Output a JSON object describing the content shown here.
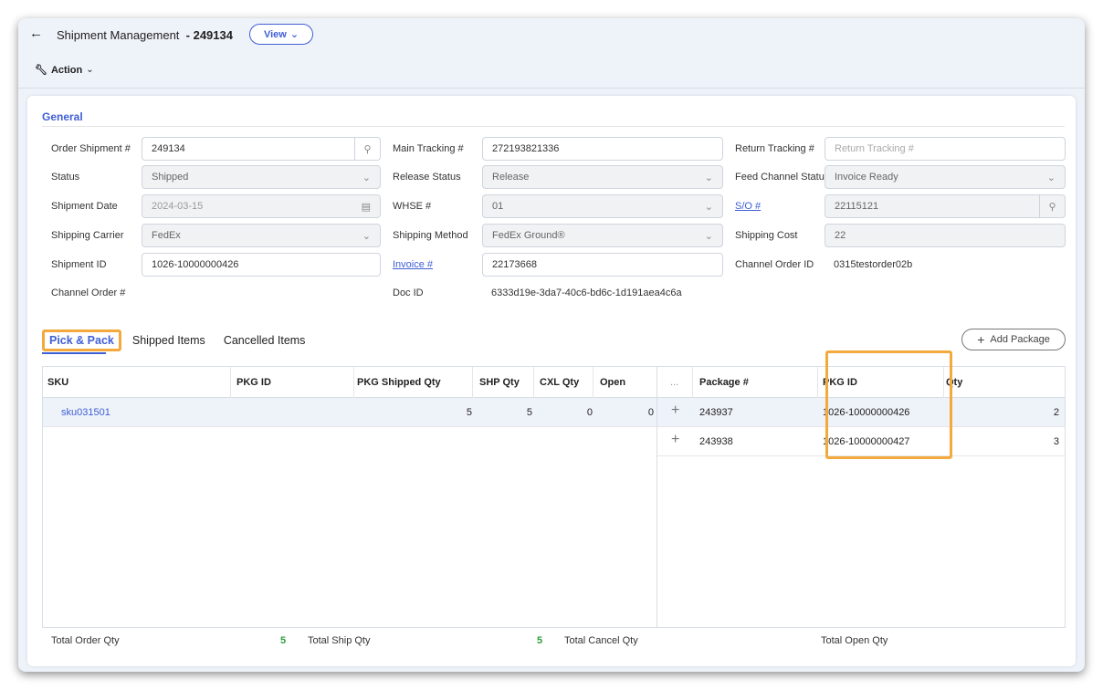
{
  "header": {
    "title": "Shipment Management",
    "shipment_no": "- 249134",
    "view_label": "View",
    "action_label": "Action"
  },
  "general": {
    "title": "General",
    "order_shipment": {
      "label": "Order Shipment #",
      "value": "249134"
    },
    "status": {
      "label": "Status",
      "value": "Shipped"
    },
    "shipment_date": {
      "label": "Shipment Date",
      "value": "2024-03-15"
    },
    "shipping_carrier": {
      "label": "Shipping Carrier",
      "value": "FedEx"
    },
    "shipment_id": {
      "label": "Shipment ID",
      "value": "1026-10000000426"
    },
    "channel_order": {
      "label": "Channel Order #"
    },
    "main_tracking": {
      "label": "Main Tracking #",
      "value": "272193821336"
    },
    "release_status": {
      "label": "Release Status",
      "value": "Release"
    },
    "whse": {
      "label": "WHSE #",
      "value": "01"
    },
    "shipping_method": {
      "label": "Shipping Method",
      "value": "FedEx Ground®"
    },
    "invoice": {
      "label": "Invoice #",
      "value": "22173668"
    },
    "doc_id": {
      "label": "Doc ID",
      "value": "6333d19e-3da7-40c6-bd6c-1d191aea4c6a"
    },
    "return_tracking": {
      "label": "Return Tracking #",
      "placeholder": "Return Tracking #"
    },
    "feed_channel_status": {
      "label": "Feed Channel Status",
      "value": "Invoice Ready"
    },
    "so": {
      "label": "S/O #",
      "value": "22115121"
    },
    "shipping_cost": {
      "label": "Shipping Cost",
      "value": "22"
    },
    "channel_order_id": {
      "label": "Channel Order ID",
      "value": "0315testorder02b"
    }
  },
  "tabs": [
    "Pick & Pack",
    "Shipped Items",
    "Cancelled Items"
  ],
  "add_package_label": "Add Package",
  "left_grid": {
    "columns": [
      "SKU",
      "PKG ID",
      "PKG Shipped Qty",
      "SHP Qty",
      "CXL Qty",
      "Open"
    ],
    "rows": [
      {
        "sku": "sku031501",
        "pkg_id": "",
        "pkg_shipped_qty": "5",
        "shp_qty": "5",
        "cxl_qty": "0",
        "open": "0"
      }
    ]
  },
  "right_grid": {
    "columns": [
      "...",
      "Package #",
      "PKG ID",
      "Qty"
    ],
    "rows": [
      {
        "package": "243937",
        "pkg_id": "1026-10000000426",
        "qty": "2"
      },
      {
        "package": "243938",
        "pkg_id": "1026-10000000427",
        "qty": "3"
      }
    ]
  },
  "totals": {
    "order_qty_label": "Total Order Qty",
    "order_qty": "5",
    "ship_qty_label": "Total Ship Qty",
    "ship_qty": "5",
    "cancel_qty_label": "Total Cancel Qty",
    "cancel_qty": "",
    "open_qty_label": "Total Open Qty"
  }
}
